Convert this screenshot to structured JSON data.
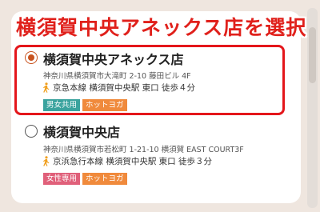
{
  "banner": {
    "title": "横須賀中央アネックス店を選択"
  },
  "stores": [
    {
      "name": "横須賀中央アネックス店",
      "address": "神奈川県横須賀市大滝町 2-10 藤田ビル 4F",
      "access": "京急本線 横須賀中央駅 東口 徒歩４分",
      "selected": true,
      "tags": [
        {
          "label": "男女共用",
          "color": "#3aa39e"
        },
        {
          "label": "ホットヨガ",
          "color": "#f08a3c"
        }
      ]
    },
    {
      "name": "横須賀中央店",
      "address": "神奈川県横須賀市若松町 1-21-10 横須賀 EAST COURT3F",
      "access": "京浜急行本線 横須賀中央駅 東口 徒歩３分",
      "selected": false,
      "tags": [
        {
          "label": "女性専用",
          "color": "#e0607a"
        },
        {
          "label": "ホットヨガ",
          "color": "#f08a3c"
        }
      ]
    }
  ],
  "colors": {
    "accent": "#e4161b",
    "radio_selected": "#c8531e",
    "walk_icon": "#f0a020"
  }
}
